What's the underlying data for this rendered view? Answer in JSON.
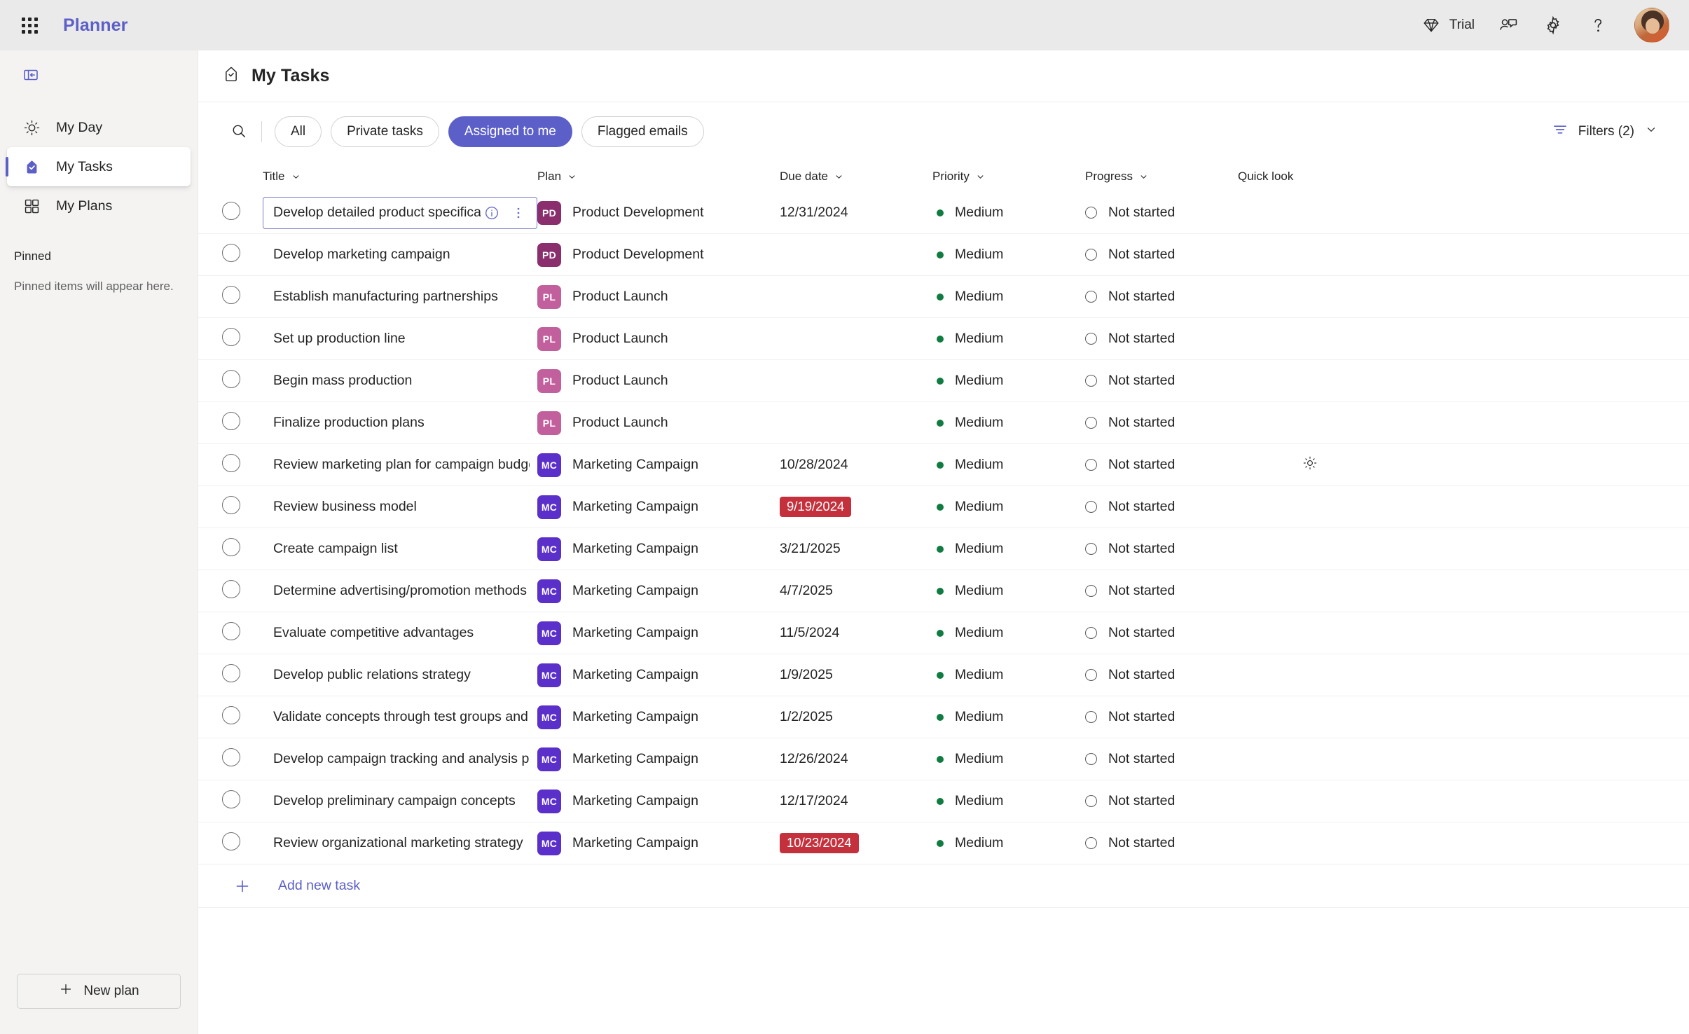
{
  "suitebar": {
    "waffle_label": "app-launcher",
    "app_title": "Planner",
    "trial_label": "Trial",
    "icons": {
      "waffle": "grid-waffle-icon",
      "diamond": "diamond-icon",
      "feedback": "person-chat-icon",
      "settings": "gear-icon",
      "help": "question-mark-icon",
      "avatar": "user-avatar"
    }
  },
  "sidebar": {
    "collapse_label": "Collapse navigation",
    "items": [
      {
        "label": "My Day",
        "icon": "sun-icon",
        "selected": false
      },
      {
        "label": "My Tasks",
        "icon": "task-badge-icon",
        "selected": true
      },
      {
        "label": "My Plans",
        "icon": "grid-four-icon",
        "selected": false
      }
    ],
    "pinned_header": "Pinned",
    "pinned_empty": "Pinned items will appear here.",
    "new_plan_label": "New plan"
  },
  "page": {
    "title": "My Tasks",
    "title_icon": "task-badge-icon"
  },
  "toolbar": {
    "search_label": "Search",
    "pills": [
      {
        "label": "All",
        "active": false
      },
      {
        "label": "Private tasks",
        "active": false
      },
      {
        "label": "Assigned to me",
        "active": true
      },
      {
        "label": "Flagged emails",
        "active": false
      }
    ],
    "filters_label": "Filters (2)"
  },
  "table": {
    "columns": [
      {
        "label": "Title",
        "sortable": true
      },
      {
        "label": "Plan",
        "sortable": true
      },
      {
        "label": "Due date",
        "sortable": true
      },
      {
        "label": "Priority",
        "sortable": true
      },
      {
        "label": "Progress",
        "sortable": true
      },
      {
        "label": "Quick look",
        "sortable": false
      }
    ],
    "add_new_task_label": "Add new task",
    "rows": [
      {
        "title": "Develop detailed product specifications",
        "plan": "Product Development",
        "plan_initials": "PD",
        "plan_color": "#8A2E6E",
        "due": "12/31/2024",
        "overdue": false,
        "priority": "Medium",
        "progress": "Not started",
        "quick_look": "",
        "focused": true
      },
      {
        "title": "Develop marketing campaign",
        "plan": "Product Development",
        "plan_initials": "PD",
        "plan_color": "#8A2E6E",
        "due": "",
        "overdue": false,
        "priority": "Medium",
        "progress": "Not started",
        "quick_look": "",
        "focused": false
      },
      {
        "title": "Establish manufacturing partnerships",
        "plan": "Product Launch",
        "plan_initials": "PL",
        "plan_color": "#C1609D",
        "due": "",
        "overdue": false,
        "priority": "Medium",
        "progress": "Not started",
        "quick_look": "",
        "focused": false
      },
      {
        "title": "Set up production line",
        "plan": "Product Launch",
        "plan_initials": "PL",
        "plan_color": "#C1609D",
        "due": "",
        "overdue": false,
        "priority": "Medium",
        "progress": "Not started",
        "quick_look": "",
        "focused": false
      },
      {
        "title": "Begin mass production",
        "plan": "Product Launch",
        "plan_initials": "PL",
        "plan_color": "#C1609D",
        "due": "",
        "overdue": false,
        "priority": "Medium",
        "progress": "Not started",
        "quick_look": "",
        "focused": false
      },
      {
        "title": "Finalize production plans",
        "plan": "Product Launch",
        "plan_initials": "PL",
        "plan_color": "#C1609D",
        "due": "",
        "overdue": false,
        "priority": "Medium",
        "progress": "Not started",
        "quick_look": "",
        "focused": false
      },
      {
        "title": "Review marketing plan for campaign budget",
        "plan": "Marketing Campaign",
        "plan_initials": "MC",
        "plan_color": "#5B2FC9",
        "due": "10/28/2024",
        "overdue": false,
        "priority": "Medium",
        "progress": "Not started",
        "quick_look": "sun-icon",
        "focused": false
      },
      {
        "title": "Review business model",
        "plan": "Marketing Campaign",
        "plan_initials": "MC",
        "plan_color": "#5B2FC9",
        "due": "9/19/2024",
        "overdue": true,
        "priority": "Medium",
        "progress": "Not started",
        "quick_look": "",
        "focused": false
      },
      {
        "title": "Create campaign list",
        "plan": "Marketing Campaign",
        "plan_initials": "MC",
        "plan_color": "#5B2FC9",
        "due": "3/21/2025",
        "overdue": false,
        "priority": "Medium",
        "progress": "Not started",
        "quick_look": "",
        "focused": false
      },
      {
        "title": "Determine advertising/promotion methods and mix",
        "plan": "Marketing Campaign",
        "plan_initials": "MC",
        "plan_color": "#5B2FC9",
        "due": "4/7/2025",
        "overdue": false,
        "priority": "Medium",
        "progress": "Not started",
        "quick_look": "",
        "focused": false
      },
      {
        "title": "Evaluate competitive advantages",
        "plan": "Marketing Campaign",
        "plan_initials": "MC",
        "plan_color": "#5B2FC9",
        "due": "11/5/2024",
        "overdue": false,
        "priority": "Medium",
        "progress": "Not started",
        "quick_look": "",
        "focused": false
      },
      {
        "title": "Develop public relations strategy",
        "plan": "Marketing Campaign",
        "plan_initials": "MC",
        "plan_color": "#5B2FC9",
        "due": "1/9/2025",
        "overdue": false,
        "priority": "Medium",
        "progress": "Not started",
        "quick_look": "",
        "focused": false
      },
      {
        "title": "Validate concepts through test groups and market resea",
        "plan": "Marketing Campaign",
        "plan_initials": "MC",
        "plan_color": "#5B2FC9",
        "due": "1/2/2025",
        "overdue": false,
        "priority": "Medium",
        "progress": "Not started",
        "quick_look": "",
        "focused": false
      },
      {
        "title": "Develop campaign tracking and analysis process",
        "plan": "Marketing Campaign",
        "plan_initials": "MC",
        "plan_color": "#5B2FC9",
        "due": "12/26/2024",
        "overdue": false,
        "priority": "Medium",
        "progress": "Not started",
        "quick_look": "",
        "focused": false
      },
      {
        "title": "Develop preliminary campaign concepts",
        "plan": "Marketing Campaign",
        "plan_initials": "MC",
        "plan_color": "#5B2FC9",
        "due": "12/17/2024",
        "overdue": false,
        "priority": "Medium",
        "progress": "Not started",
        "quick_look": "",
        "focused": false
      },
      {
        "title": "Review organizational marketing strategy",
        "plan": "Marketing Campaign",
        "plan_initials": "MC",
        "plan_color": "#5B2FC9",
        "due": "10/23/2024",
        "overdue": true,
        "priority": "Medium",
        "progress": "Not started",
        "quick_look": "",
        "focused": false
      }
    ]
  },
  "colors": {
    "accent": "#5b5fc7",
    "overdue": "#c4313c",
    "priority_medium": "#107c41",
    "suitebar_bg": "#eaeaea",
    "leftnav_bg": "#f4f3f2"
  }
}
